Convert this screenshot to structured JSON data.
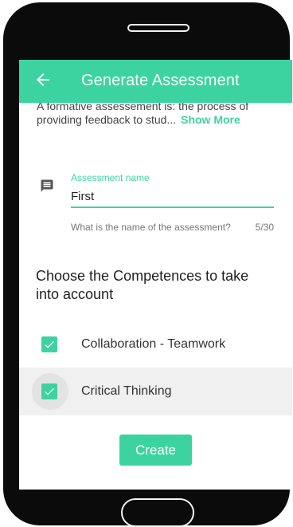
{
  "appbar": {
    "title": "Generate Assessment",
    "back_icon": "arrow-left-icon"
  },
  "intro": {
    "line1": "A formative assessement is: the process of",
    "line2": "providing feedback to stud...",
    "show_more": "Show More"
  },
  "assessment_field": {
    "icon": "message-icon",
    "label": "Assessment name",
    "value": "First",
    "helper": "What is the name of the assessment?",
    "counter": "5/30"
  },
  "competences": {
    "heading": "Choose the Competences to take into account",
    "items": [
      {
        "label": "Collaboration - Teamwork",
        "checked": true
      },
      {
        "label": "Critical Thinking",
        "checked": true
      }
    ]
  },
  "actions": {
    "create_label": "Create"
  },
  "colors": {
    "accent": "#3dd3a0",
    "phone_body": "#0b0b0b"
  }
}
